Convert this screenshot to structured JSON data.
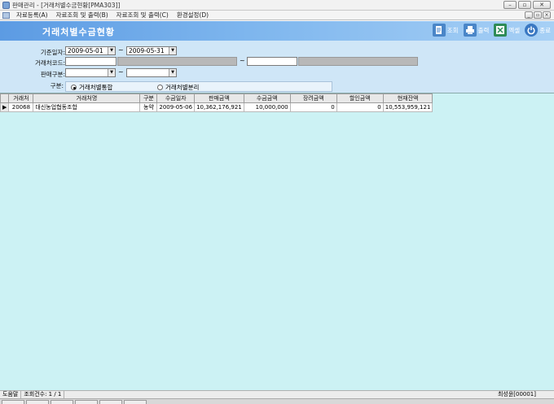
{
  "window": {
    "title": "판매관리 - [거래처별수금현황[PMA303]]",
    "buttons": {
      "minimize": "–",
      "restore": "▫",
      "close": "✕"
    }
  },
  "menu": {
    "items": [
      "자료등록(A)",
      "자료조회 및 출력(B)",
      "자료조회 및 출력(C)",
      "환경설정(D)"
    ],
    "mdi": {
      "minimize": "_",
      "restore": "▫",
      "close": "×"
    }
  },
  "header": {
    "title": "거래처별수금현황",
    "tools": [
      {
        "label": "조회",
        "icon": "search-doc-icon",
        "color": "#4a86c8"
      },
      {
        "label": "출력",
        "icon": "printer-icon",
        "color": "#4a86c8"
      },
      {
        "label": "엑셀",
        "icon": "excel-icon",
        "color": "#2e8b57"
      },
      {
        "label": "종료",
        "icon": "power-icon",
        "color": "#3a78c2"
      }
    ]
  },
  "filters": {
    "date_label": "기준일자:",
    "date_from": "2009-05-01",
    "date_to": "2009-05-31",
    "tilde": "~",
    "customer_code_label": "거래처코드:",
    "customer_from": "",
    "customer_to": "",
    "sales_type_label": "판매구분:",
    "sales_from": "",
    "sales_to": "",
    "group_label": "구분:",
    "radio_combined": "거래처별통합",
    "radio_separate": "거래처별분리",
    "selected": "combined"
  },
  "grid": {
    "columns": [
      "거래처",
      "거래처명",
      "구분",
      "수금일자",
      "판매금액",
      "수금금액",
      "장려금액",
      "할인금액",
      "현재잔액"
    ],
    "rows": [
      {
        "indicator": "▶",
        "code": "20068",
        "name": "대신농업협동조합",
        "type": "농약",
        "date": "2009-05-06",
        "sales": "10,362,176,921",
        "collected": "10,000,000",
        "incentive": "0",
        "discount": "0",
        "balance": "10,553,959,121"
      }
    ]
  },
  "status": {
    "left": "도움말",
    "count": "조회건수: 1 / 1",
    "user": "최성윤[00001]"
  }
}
